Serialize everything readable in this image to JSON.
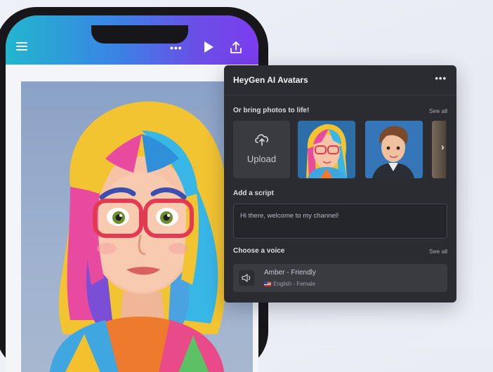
{
  "phone": {
    "toolbar": {
      "menu_icon": "hamburger-menu-icon",
      "more_icon": "more-horizontal-icon",
      "more_glyph": "•••",
      "play_icon": "play-icon",
      "share_icon": "share-upload-icon"
    },
    "canvas": {
      "image_description": "3D cartoon avatar of a woman with rainbow hair and red glasses"
    }
  },
  "panel": {
    "title": "HeyGen AI Avatars",
    "menu_glyph": "•••",
    "photos_section": {
      "label": "Or bring photos to life!",
      "see_all": "See all",
      "upload_label": "Upload",
      "next_glyph": "›"
    },
    "script_section": {
      "label": "Add a script",
      "value": "Hi there, welcome to my channel!"
    },
    "voice_section": {
      "label": "Choose a voice",
      "see_all": "See all",
      "voice_name": "Amber - Friendly",
      "voice_meta": "English - Female"
    }
  },
  "colors": {
    "panel_bg": "#2a2c31",
    "appbar_gradient_start": "#22b6cf",
    "appbar_gradient_end": "#7c3cf0",
    "page_bg": "#eef0f7"
  }
}
